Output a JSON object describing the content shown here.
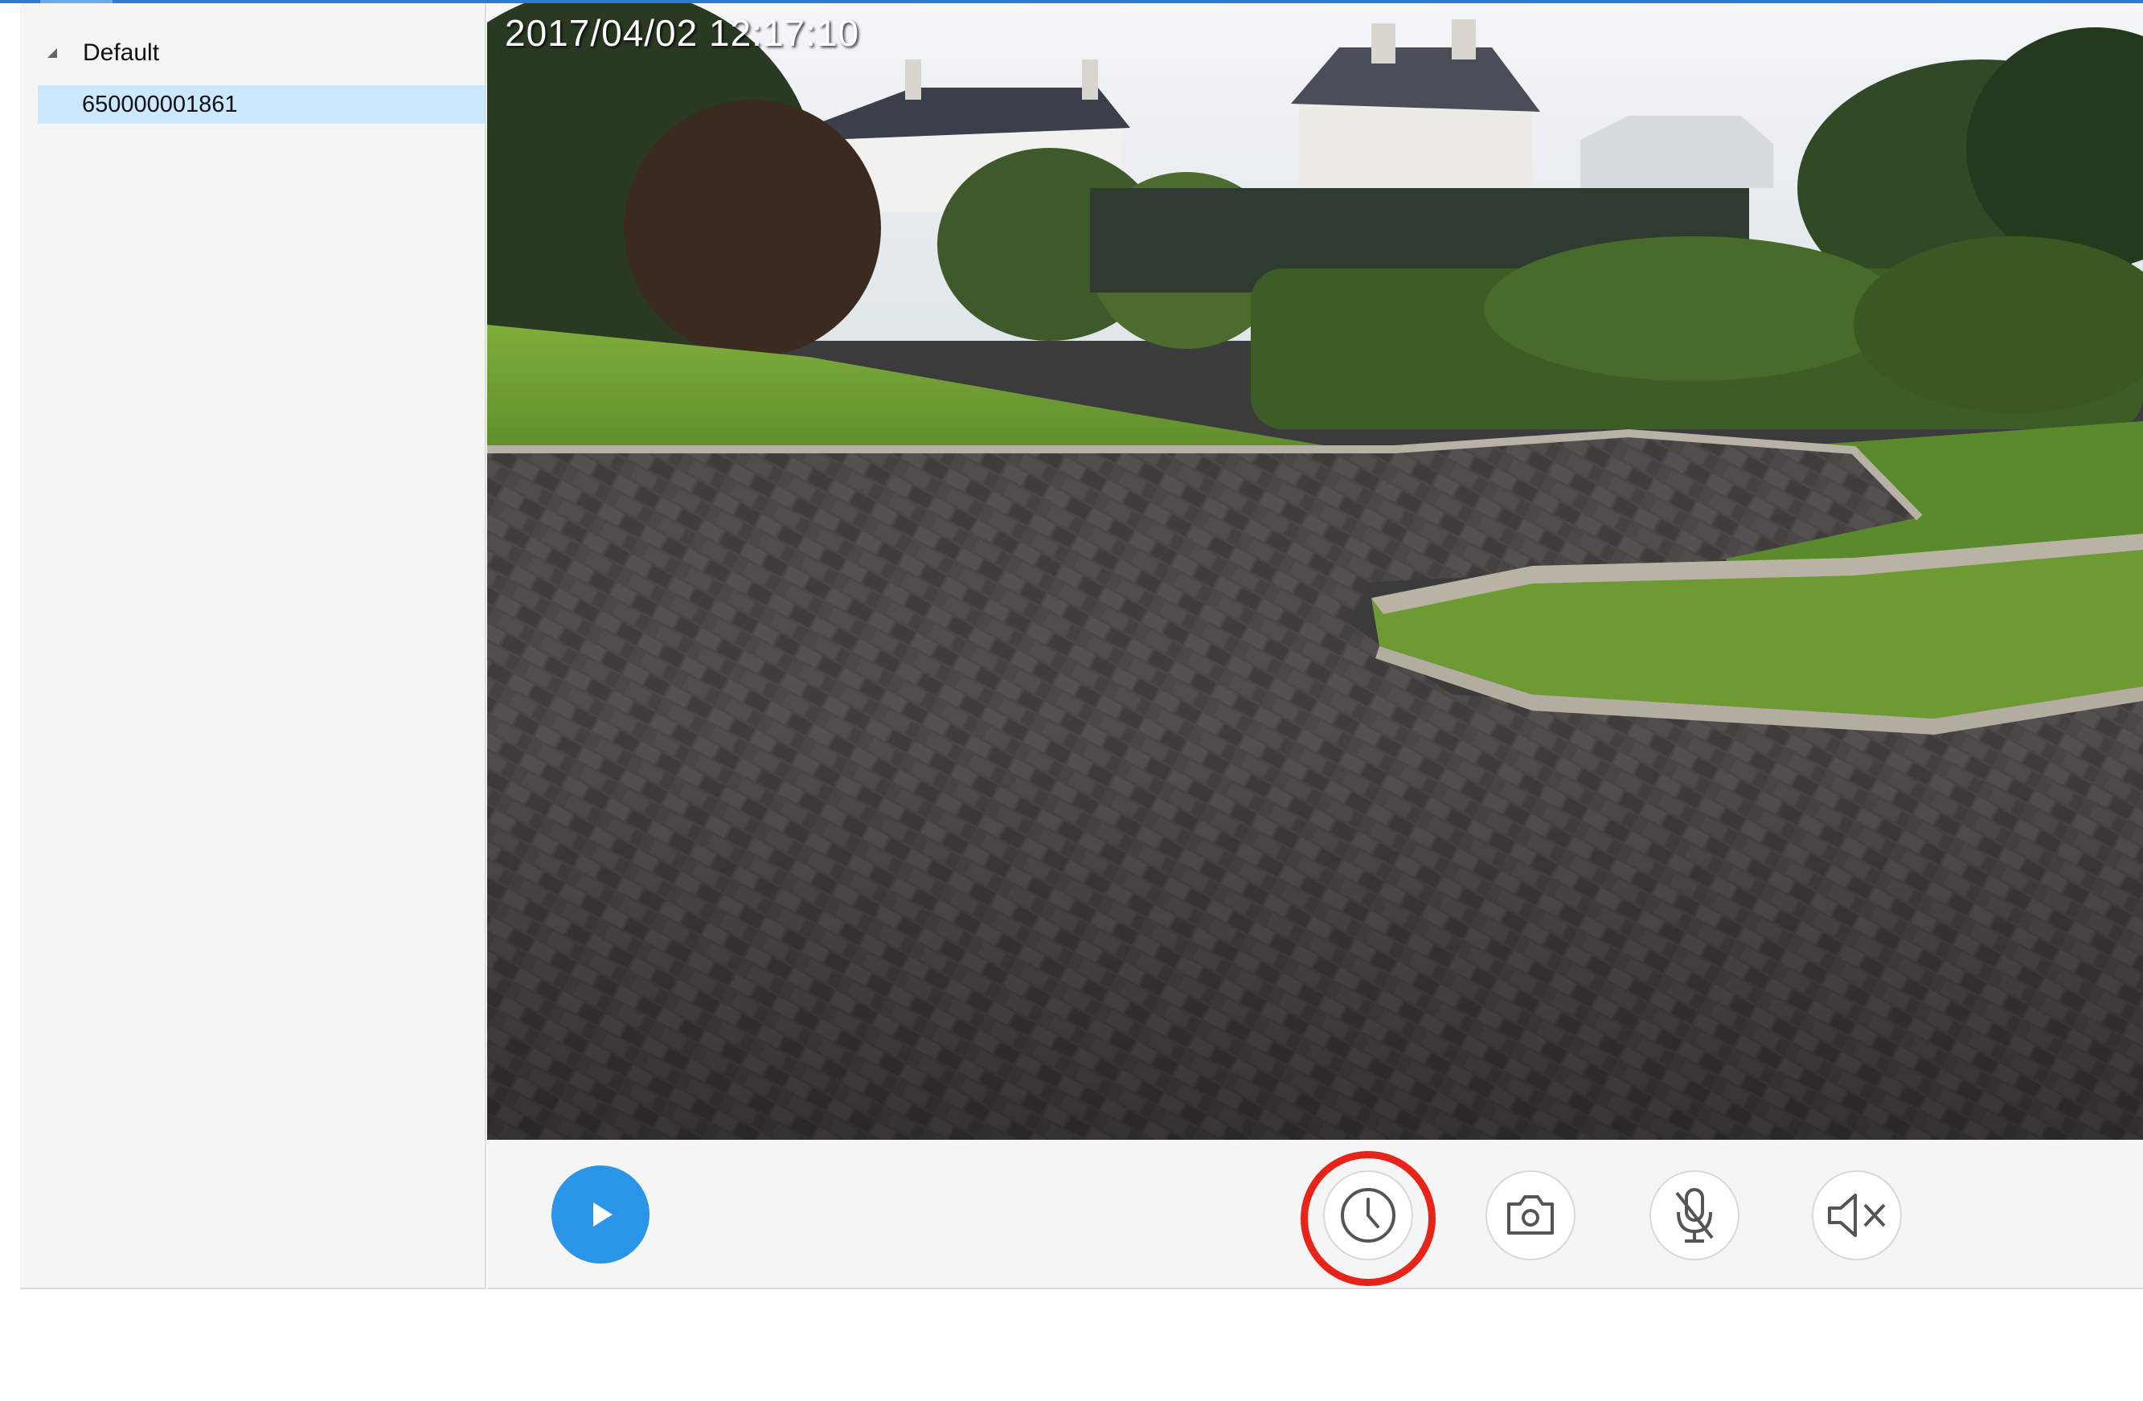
{
  "sidebar": {
    "group": {
      "label": "Default",
      "expanded": true
    },
    "devices": [
      {
        "label": "650000001861",
        "selected": true
      }
    ]
  },
  "video": {
    "timestamp": "2017/04/02  12:17:10"
  },
  "controls": {
    "play": {
      "icon": "play-icon"
    },
    "buttons": [
      {
        "id": "record",
        "icon": "clock-icon",
        "highlighted": true
      },
      {
        "id": "snapshot",
        "icon": "camera-icon"
      },
      {
        "id": "microphone",
        "icon": "microphone-muted-icon"
      },
      {
        "id": "speaker",
        "icon": "speaker-muted-icon"
      }
    ]
  },
  "colors": {
    "accent": "#2a95e6",
    "selection": "#cce8ff",
    "highlight": "#e8231a"
  }
}
